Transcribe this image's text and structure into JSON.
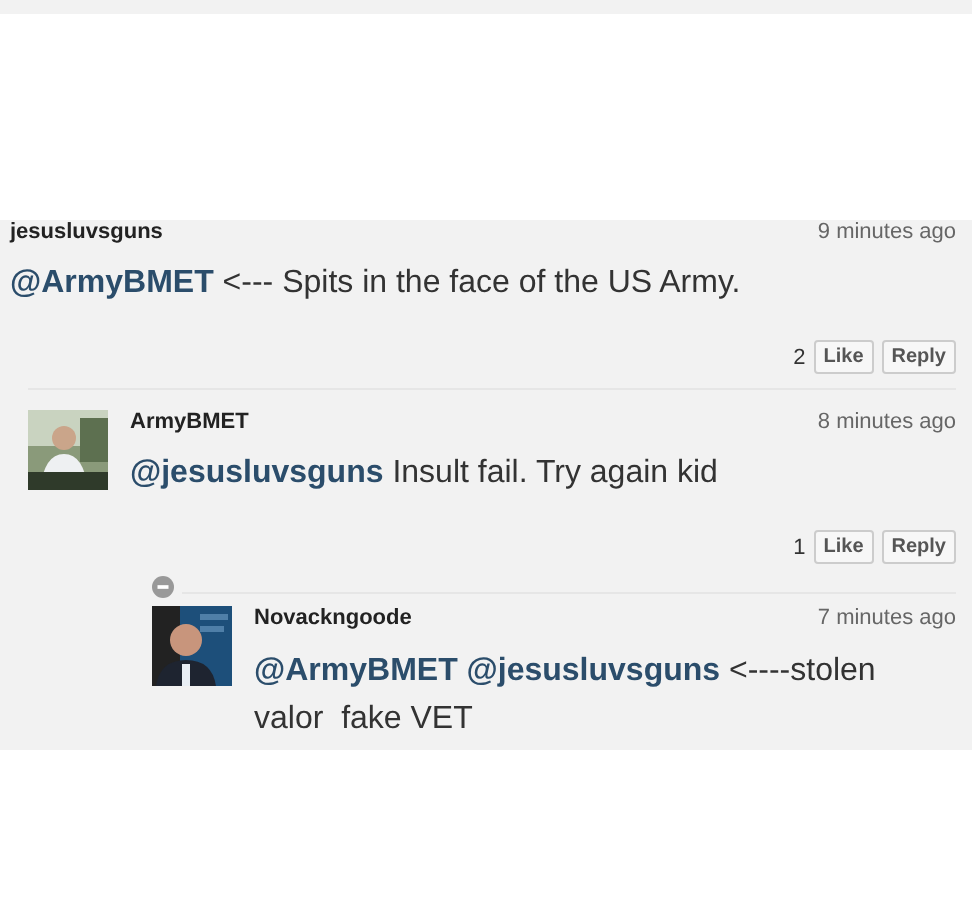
{
  "comments": [
    {
      "author": "jesusluvsguns",
      "time": "9 minutes ago",
      "body": "**@ArmyBMET** <--- Spits in the face of the US Army.",
      "likes": "2",
      "like_label": "Like",
      "reply_label": "Reply",
      "children": [
        {
          "author": "ArmyBMET",
          "time": "8 minutes ago",
          "body": "**@jesusluvsguns** Insult fail. Try again kid",
          "likes": "1",
          "like_label": "Like",
          "reply_label": "Reply",
          "children": [
            {
              "author": "Novackngoode",
              "time": "7 minutes ago",
              "expanded": true,
              "body": "**@ArmyBMET @jesusluvsguns** <----stolen valor  fake VET"
            }
          ]
        }
      ]
    }
  ]
}
